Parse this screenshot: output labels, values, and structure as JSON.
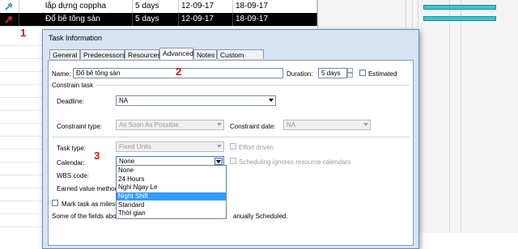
{
  "table": {
    "rows": [
      {
        "icon": "task-icon",
        "name": "lắp dựng coppha",
        "duration": "5 days",
        "start": "12-09-17",
        "finish": "18-09-17",
        "selected": false
      },
      {
        "icon": "pin-task-icon",
        "name": "Đổ bê tông sàn",
        "duration": "5 days",
        "start": "12-09-17",
        "finish": "18-09-17",
        "selected": true
      }
    ]
  },
  "annotations": {
    "m1": "1",
    "m2": "2",
    "m3": "3"
  },
  "dialog": {
    "title": "Task Information",
    "tabs": [
      "General",
      "Predecessors",
      "Resources",
      "Advanced",
      "Notes",
      "Custom Fields"
    ],
    "active_tab": "Advanced",
    "name_label": "Name:",
    "name_value": "Đổ bê tông sàn",
    "duration_label": "Duration:",
    "duration_value": "5 days",
    "estimated_label": "Estimated",
    "constrain_heading": "Constrain task",
    "deadline_label": "Deadline:",
    "deadline_value": "NA",
    "constraint_type_label": "Constraint type:",
    "constraint_type_value": "As Soon As Possible",
    "constraint_date_label": "Constraint date:",
    "constraint_date_value": "NA",
    "task_type_label": "Task type:",
    "task_type_value": "Fixed Units",
    "effort_driven_label": "Effort driven",
    "calendar_label": "Calendar:",
    "calendar_value": "None",
    "scheduling_label": "Scheduling ignores resource calendars",
    "wbs_label": "WBS code:",
    "earned_value_label": "Earned value method:",
    "mark_milestone_label": "Mark task as milesto",
    "footer_left": "Some of the fields abov",
    "footer_right": "anually Scheduled.",
    "calendar_options": [
      "None",
      "24 Hours",
      "Nghi Ngay Le",
      "Night Shift",
      "Standard",
      "Thời gian"
    ],
    "highlighted_option": "Night Shift"
  },
  "colors": {
    "gantt_bar": "#39c6cf",
    "marker": "#e01010",
    "highlight": "#3399ff"
  }
}
